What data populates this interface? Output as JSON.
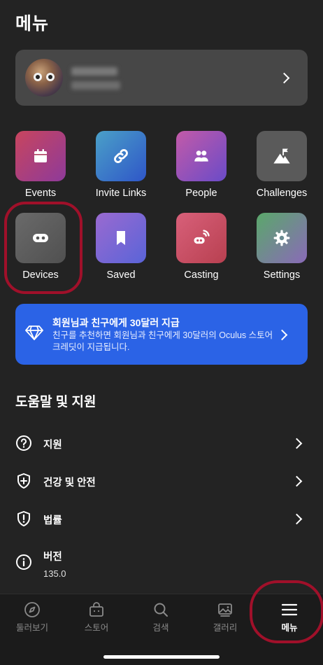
{
  "header": {
    "title": "메뉴"
  },
  "grid": [
    {
      "label": "Events",
      "icon": "calendar-icon"
    },
    {
      "label": "Invite Links",
      "icon": "link-icon"
    },
    {
      "label": "People",
      "icon": "people-icon"
    },
    {
      "label": "Challenges",
      "icon": "flag-mountain-icon"
    },
    {
      "label": "Devices",
      "icon": "vr-headset-icon"
    },
    {
      "label": "Saved",
      "icon": "bookmark-icon"
    },
    {
      "label": "Casting",
      "icon": "casting-icon"
    },
    {
      "label": "Settings",
      "icon": "gear-icon"
    }
  ],
  "promo": {
    "title": "회원님과 친구에게 30달러 지급",
    "body": "친구를 추천하면 회원님과 친구에게 30달러의 Oculus 스토어 크레딧이 지급됩니다."
  },
  "help": {
    "heading": "도움말 및 지원",
    "items": [
      {
        "label": "지원",
        "icon": "question-icon"
      },
      {
        "label": "건강 및 안전",
        "icon": "shield-plus-icon"
      },
      {
        "label": "법률",
        "icon": "shield-alert-icon"
      },
      {
        "label": "버전",
        "value": "135.0",
        "icon": "info-icon"
      }
    ]
  },
  "tabs": [
    {
      "label": "둘러보기",
      "icon": "compass-icon"
    },
    {
      "label": "스토어",
      "icon": "store-bag-icon"
    },
    {
      "label": "검색",
      "icon": "search-icon"
    },
    {
      "label": "갤러리",
      "icon": "gallery-icon"
    },
    {
      "label": "메뉴",
      "icon": "menu-icon",
      "active": true
    }
  ],
  "colors": {
    "background": "#232323",
    "card": "#474747",
    "promo": "#2b63e6",
    "highlight": "#a0102a"
  }
}
